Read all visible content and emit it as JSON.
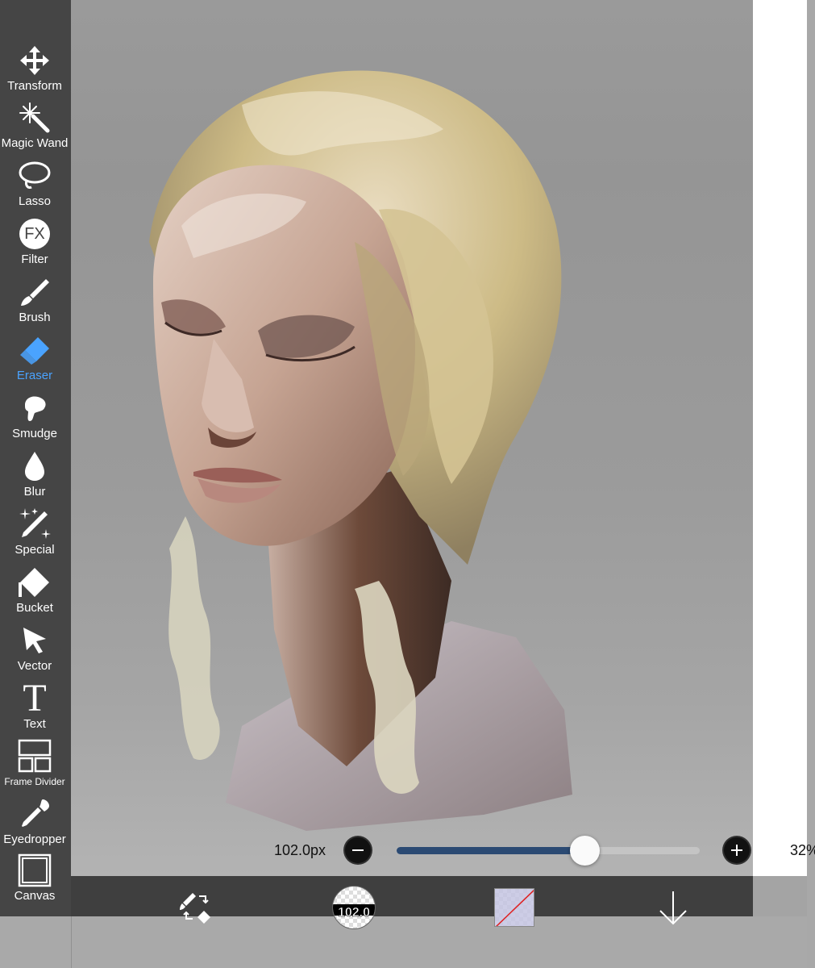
{
  "toolbar": {
    "tools": [
      {
        "label": "Transform",
        "icon": "move-arrows-icon"
      },
      {
        "label": "Magic Wand",
        "icon": "magic-wand-icon"
      },
      {
        "label": "Lasso",
        "icon": "lasso-icon"
      },
      {
        "label": "Filter",
        "icon": "fx-icon",
        "glyph": "FX"
      },
      {
        "label": "Brush",
        "icon": "brush-icon"
      },
      {
        "label": "Eraser",
        "icon": "eraser-icon",
        "active": true
      },
      {
        "label": "Smudge",
        "icon": "smudge-icon"
      },
      {
        "label": "Blur",
        "icon": "droplet-icon"
      },
      {
        "label": "Special",
        "icon": "sparkle-pen-icon"
      },
      {
        "label": "Bucket",
        "icon": "bucket-icon"
      },
      {
        "label": "Vector",
        "icon": "cursor-arrow-icon"
      },
      {
        "label": "Text",
        "icon": "text-t-icon",
        "glyph": "T"
      },
      {
        "label": "Frame Divider",
        "icon": "frame-divider-icon"
      },
      {
        "label": "Eyedropper",
        "icon": "eyedropper-icon"
      },
      {
        "label": "Canvas",
        "icon": "canvas-square-icon"
      }
    ],
    "active_color": "#4aa3ff"
  },
  "brush_controls": {
    "size_label": "102.0px",
    "size_fraction": 0.62,
    "opacity_label": "32%",
    "minus_icon": "minus-circle-icon",
    "plus_icon": "plus-circle-icon",
    "slider_fill_color": "#2b4a73"
  },
  "bottom_bar": {
    "swap_icon": "brush-eraser-swap-icon",
    "brush_preview_value": "102.0",
    "color_swatch": "#c4c4e2",
    "download_icon": "down-arrow-icon"
  }
}
